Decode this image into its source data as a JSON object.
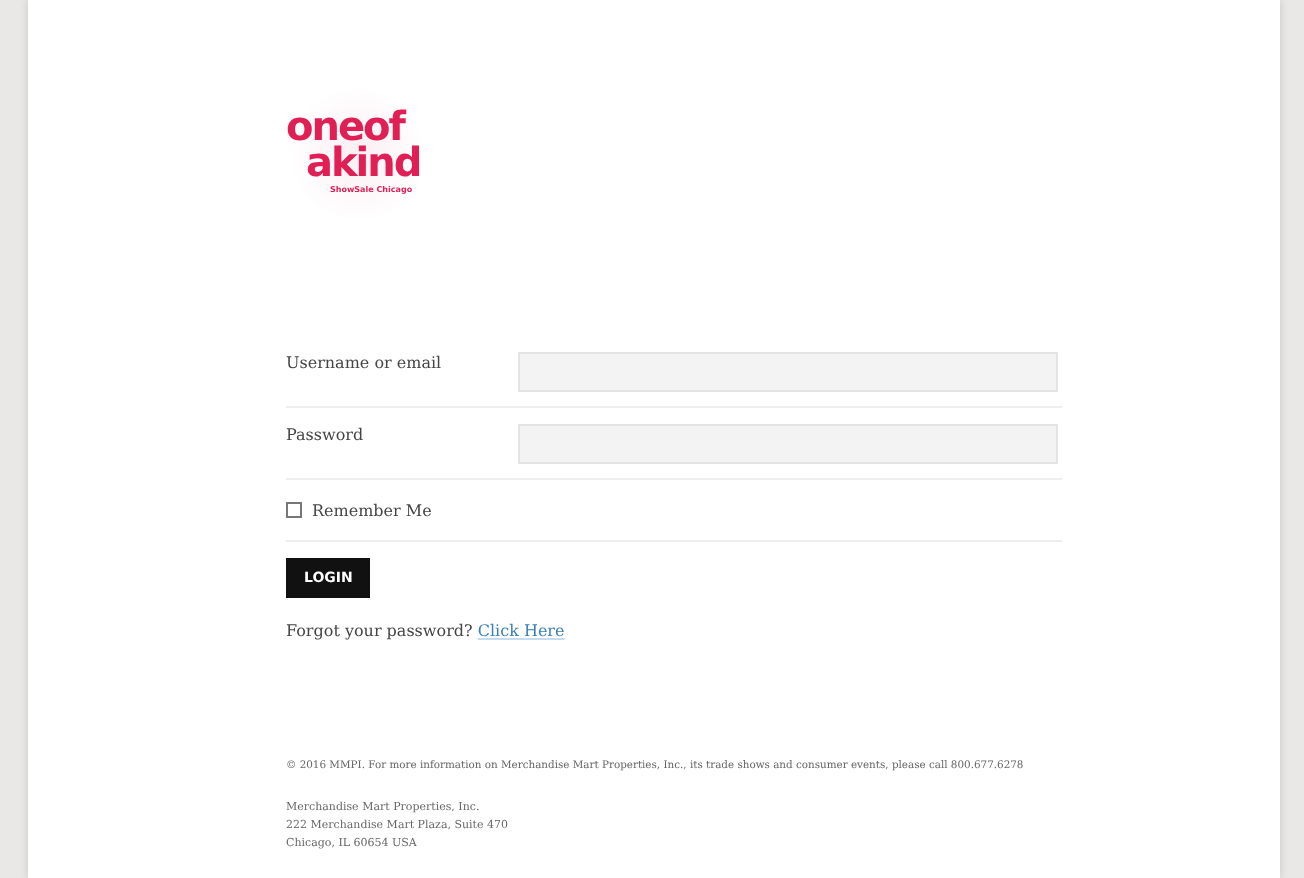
{
  "logo": {
    "line_1": "oneof",
    "line_2": "akind",
    "tagline": "ShowSale Chicago"
  },
  "form": {
    "fields": [
      {
        "label": "Username or email"
      },
      {
        "label": "Password"
      }
    ],
    "remember": {
      "label": "Remember Me",
      "checked": false
    },
    "button": "LOGIN",
    "forgot": {
      "text": "Forgot your password?",
      "link": "Click Here"
    }
  },
  "footer": {
    "copyright": "© 2016 MMPI. For more information on Merchandise Mart Properties, Inc., its trade shows and consumer events, please call 800.677.6278",
    "address": [
      "Merchandise Mart Properties, Inc.",
      "222 Merchandise Mart Plaza, Suite 470",
      "Chicago, IL 60654 USA"
    ]
  }
}
